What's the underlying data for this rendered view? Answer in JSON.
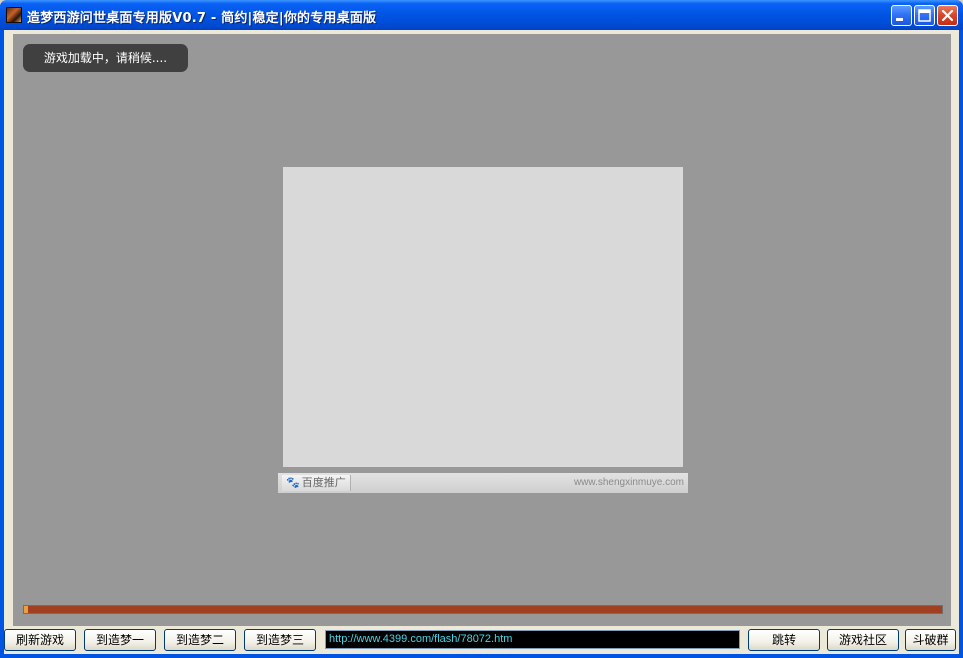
{
  "window": {
    "title": "造梦西游问世桌面专用版V0.7 - 简约|稳定|你的专用桌面版",
    "icon": "game-app-icon"
  },
  "title_buttons": {
    "minimize_icon": "minimize-icon",
    "maximize_icon": "maximize-icon",
    "close_icon": "close-icon"
  },
  "game": {
    "loading_text": "游戏加载中，请稍候....",
    "ad_logo_label": "百度推广",
    "ad_url": "www.shengxinmuye.com",
    "progress_fraction": 0.004
  },
  "toolbar": {
    "buttons": [
      {
        "label": "刷新游戏"
      },
      {
        "label": "到造梦一"
      },
      {
        "label": "到造梦二"
      },
      {
        "label": "到造梦三"
      }
    ],
    "url_value": "http://www.4399.com/flash/78072.htm",
    "jump_label": "跳转",
    "community_label": "游戏社区",
    "group_label": "斗破群"
  },
  "colors": {
    "titlebar": "#0054e3",
    "game_bg": "#989898",
    "progress_track": "#a04020",
    "url_text": "#46d6e6"
  }
}
